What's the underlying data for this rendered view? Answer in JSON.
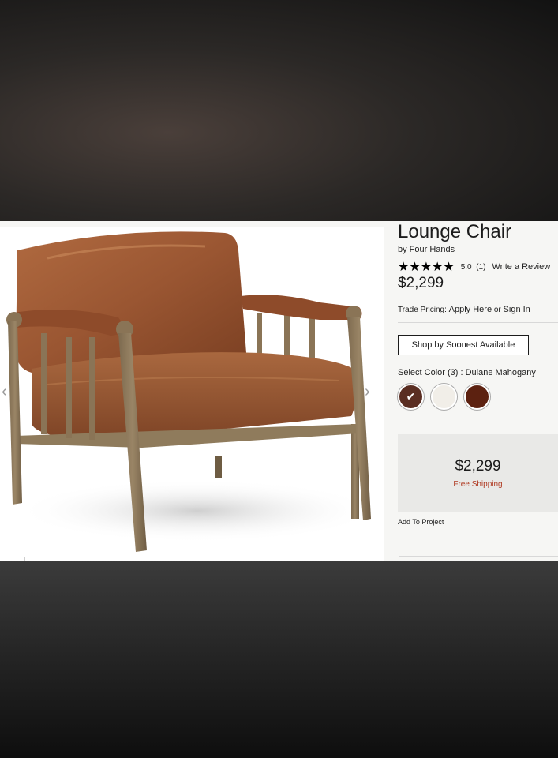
{
  "product": {
    "title": "Lounge Chair",
    "brand": "by Four Hands",
    "stars_icon": "★★★★★",
    "rating_value": 5.0,
    "rating_text": "5.0",
    "review_count": "(1)",
    "write_review": "Write a Review",
    "price": "$2,299"
  },
  "trade": {
    "label": "Trade Pricing:",
    "apply_link": "Apply Here",
    "or_text": "or",
    "sign_in_link": "Sign In"
  },
  "shop_button": "Shop by Soonest Available",
  "color": {
    "label": "Select Color (3) : Dulane Mahogany",
    "swatches": [
      {
        "name": "dulane-mahogany",
        "color": "#5a2e22",
        "selected": true
      },
      {
        "name": "white",
        "color": "#f1eee8",
        "selected": false
      },
      {
        "name": "dark-mahogany",
        "color": "#5c2110",
        "selected": false
      }
    ]
  },
  "price_box": {
    "price": "$2,299",
    "shipping": "Free Shipping"
  },
  "add_to_project": "Add To Project",
  "gallery": {
    "prev_icon": "‹",
    "next_icon": "›"
  },
  "colors": {
    "leather": "#9a5632",
    "wood": "#8a7456",
    "shipping_text": "#b03a22"
  }
}
